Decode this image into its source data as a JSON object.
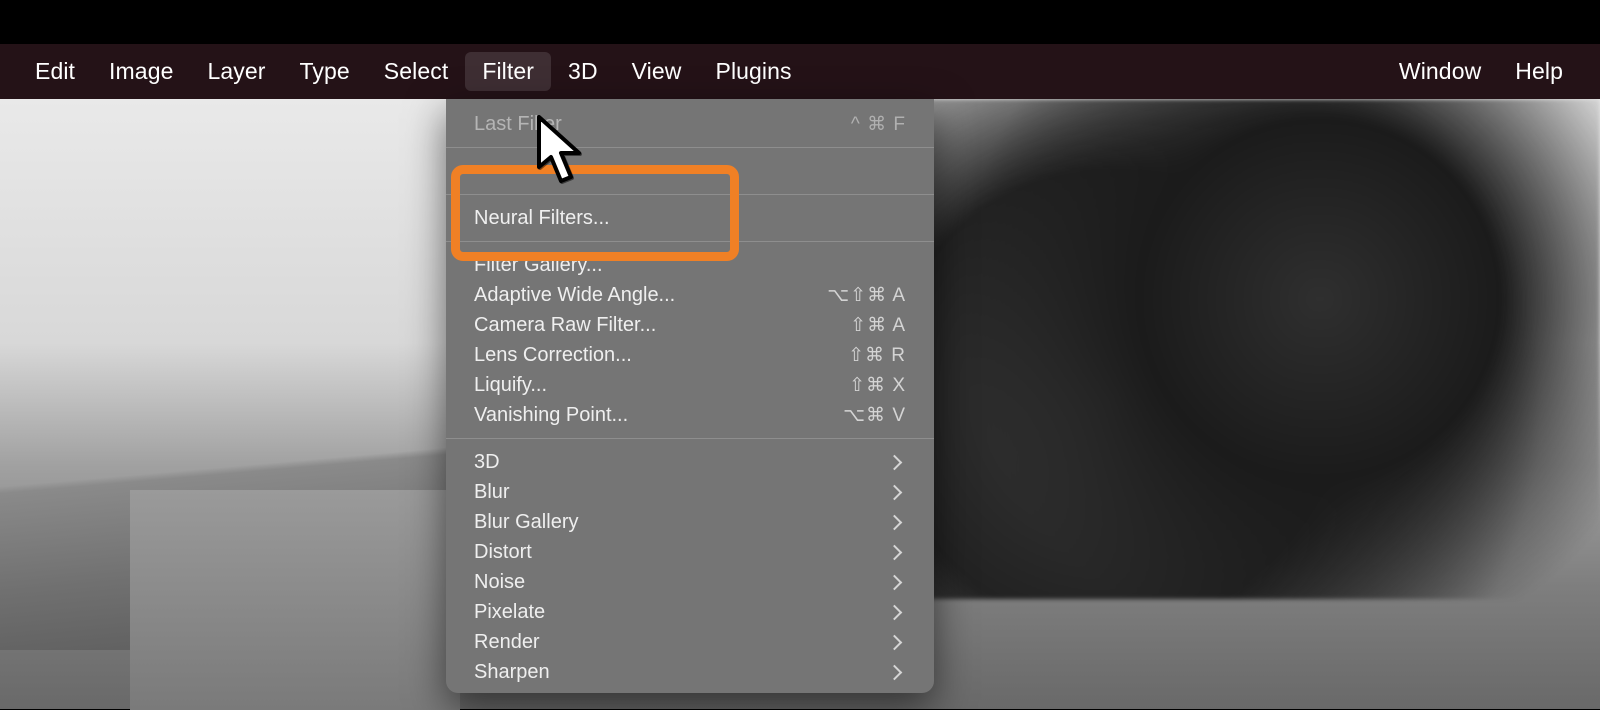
{
  "menubar": {
    "left": [
      {
        "id": "edit",
        "label": "Edit"
      },
      {
        "id": "image",
        "label": "Image"
      },
      {
        "id": "layer",
        "label": "Layer"
      },
      {
        "id": "type",
        "label": "Type"
      },
      {
        "id": "select",
        "label": "Select"
      },
      {
        "id": "filter",
        "label": "Filter",
        "active": true
      },
      {
        "id": "3d",
        "label": "3D"
      },
      {
        "id": "view",
        "label": "View"
      },
      {
        "id": "plugins",
        "label": "Plugins"
      }
    ],
    "right": [
      {
        "id": "window",
        "label": "Window"
      },
      {
        "id": "help",
        "label": "Help"
      }
    ]
  },
  "dropdown": {
    "section1": {
      "last_filter": {
        "label": "Last Filter",
        "shortcut": "^ ⌘ F",
        "disabled": true
      }
    },
    "section2": {
      "hidden": {
        "label": "",
        "shortcut": ""
      }
    },
    "section3": {
      "neural_filters": {
        "label": "Neural Filters..."
      }
    },
    "section4": {
      "filter_gallery": {
        "label": "Filter Gallery..."
      },
      "adaptive_wide_angle": {
        "label": "Adaptive Wide Angle...",
        "shortcut": "⌥⇧⌘ A"
      },
      "camera_raw": {
        "label": "Camera Raw Filter...",
        "shortcut": "⇧⌘ A"
      },
      "lens_correction": {
        "label": "Lens Correction...",
        "shortcut": "⇧⌘ R"
      },
      "liquify": {
        "label": "Liquify...",
        "shortcut": "⇧⌘ X"
      },
      "vanishing_point": {
        "label": "Vanishing Point...",
        "shortcut": "⌥⌘ V"
      }
    },
    "section5": {
      "3d": {
        "label": "3D",
        "submenu": true
      },
      "blur": {
        "label": "Blur",
        "submenu": true
      },
      "blur_gallery": {
        "label": "Blur Gallery",
        "submenu": true
      },
      "distort": {
        "label": "Distort",
        "submenu": true
      },
      "noise": {
        "label": "Noise",
        "submenu": true
      },
      "pixelate": {
        "label": "Pixelate",
        "submenu": true
      },
      "render": {
        "label": "Render",
        "submenu": true
      },
      "sharpen": {
        "label": "Sharpen",
        "submenu": true
      }
    }
  },
  "highlight": {
    "target": "neural_filters"
  }
}
